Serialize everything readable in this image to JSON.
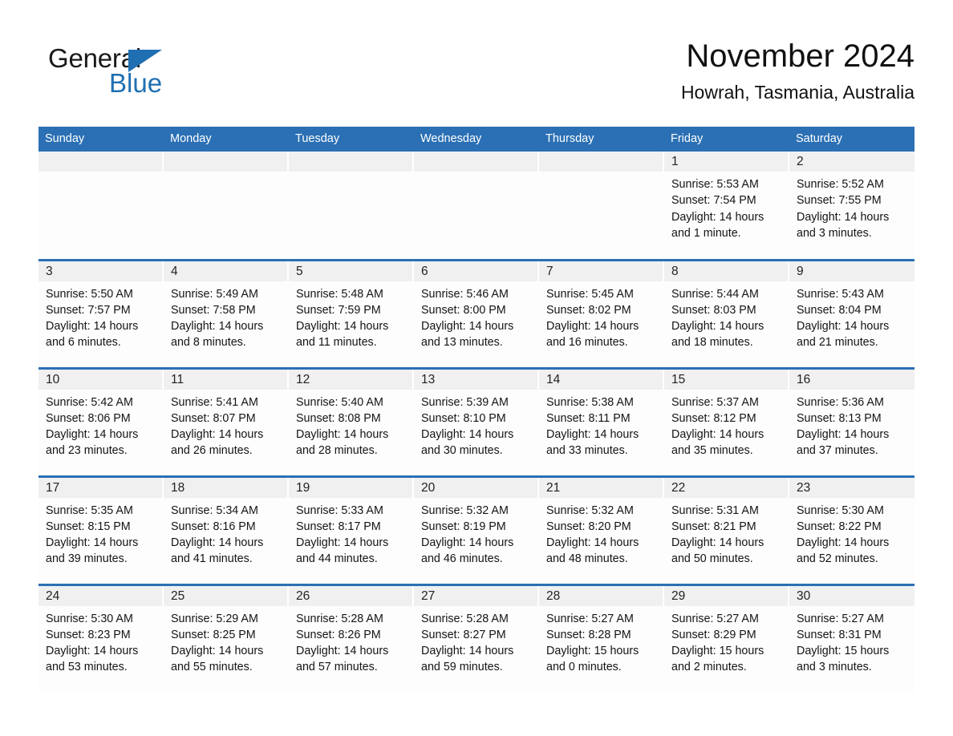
{
  "brand": {
    "word_one": "General",
    "word_two": "Blue",
    "triangle_color": "#1f6fb2"
  },
  "header": {
    "month_title": "November 2024",
    "location": "Howrah, Tasmania, Australia"
  },
  "theme": {
    "header_blue": "#2b70b4",
    "daynum_band": "#f0f0f0",
    "cell_bg": "#fdfdfd",
    "text": "#141414"
  },
  "weekday_headers": [
    "Sunday",
    "Monday",
    "Tuesday",
    "Wednesday",
    "Thursday",
    "Friday",
    "Saturday"
  ],
  "weeks": [
    [
      {
        "day": "",
        "sunrise": "",
        "sunset": "",
        "daylight_line1": "",
        "daylight_line2": ""
      },
      {
        "day": "",
        "sunrise": "",
        "sunset": "",
        "daylight_line1": "",
        "daylight_line2": ""
      },
      {
        "day": "",
        "sunrise": "",
        "sunset": "",
        "daylight_line1": "",
        "daylight_line2": ""
      },
      {
        "day": "",
        "sunrise": "",
        "sunset": "",
        "daylight_line1": "",
        "daylight_line2": ""
      },
      {
        "day": "",
        "sunrise": "",
        "sunset": "",
        "daylight_line1": "",
        "daylight_line2": ""
      },
      {
        "day": "1",
        "sunrise": "Sunrise: 5:53 AM",
        "sunset": "Sunset: 7:54 PM",
        "daylight_line1": "Daylight: 14 hours",
        "daylight_line2": "and 1 minute."
      },
      {
        "day": "2",
        "sunrise": "Sunrise: 5:52 AM",
        "sunset": "Sunset: 7:55 PM",
        "daylight_line1": "Daylight: 14 hours",
        "daylight_line2": "and 3 minutes."
      }
    ],
    [
      {
        "day": "3",
        "sunrise": "Sunrise: 5:50 AM",
        "sunset": "Sunset: 7:57 PM",
        "daylight_line1": "Daylight: 14 hours",
        "daylight_line2": "and 6 minutes."
      },
      {
        "day": "4",
        "sunrise": "Sunrise: 5:49 AM",
        "sunset": "Sunset: 7:58 PM",
        "daylight_line1": "Daylight: 14 hours",
        "daylight_line2": "and 8 minutes."
      },
      {
        "day": "5",
        "sunrise": "Sunrise: 5:48 AM",
        "sunset": "Sunset: 7:59 PM",
        "daylight_line1": "Daylight: 14 hours",
        "daylight_line2": "and 11 minutes."
      },
      {
        "day": "6",
        "sunrise": "Sunrise: 5:46 AM",
        "sunset": "Sunset: 8:00 PM",
        "daylight_line1": "Daylight: 14 hours",
        "daylight_line2": "and 13 minutes."
      },
      {
        "day": "7",
        "sunrise": "Sunrise: 5:45 AM",
        "sunset": "Sunset: 8:02 PM",
        "daylight_line1": "Daylight: 14 hours",
        "daylight_line2": "and 16 minutes."
      },
      {
        "day": "8",
        "sunrise": "Sunrise: 5:44 AM",
        "sunset": "Sunset: 8:03 PM",
        "daylight_line1": "Daylight: 14 hours",
        "daylight_line2": "and 18 minutes."
      },
      {
        "day": "9",
        "sunrise": "Sunrise: 5:43 AM",
        "sunset": "Sunset: 8:04 PM",
        "daylight_line1": "Daylight: 14 hours",
        "daylight_line2": "and 21 minutes."
      }
    ],
    [
      {
        "day": "10",
        "sunrise": "Sunrise: 5:42 AM",
        "sunset": "Sunset: 8:06 PM",
        "daylight_line1": "Daylight: 14 hours",
        "daylight_line2": "and 23 minutes."
      },
      {
        "day": "11",
        "sunrise": "Sunrise: 5:41 AM",
        "sunset": "Sunset: 8:07 PM",
        "daylight_line1": "Daylight: 14 hours",
        "daylight_line2": "and 26 minutes."
      },
      {
        "day": "12",
        "sunrise": "Sunrise: 5:40 AM",
        "sunset": "Sunset: 8:08 PM",
        "daylight_line1": "Daylight: 14 hours",
        "daylight_line2": "and 28 minutes."
      },
      {
        "day": "13",
        "sunrise": "Sunrise: 5:39 AM",
        "sunset": "Sunset: 8:10 PM",
        "daylight_line1": "Daylight: 14 hours",
        "daylight_line2": "and 30 minutes."
      },
      {
        "day": "14",
        "sunrise": "Sunrise: 5:38 AM",
        "sunset": "Sunset: 8:11 PM",
        "daylight_line1": "Daylight: 14 hours",
        "daylight_line2": "and 33 minutes."
      },
      {
        "day": "15",
        "sunrise": "Sunrise: 5:37 AM",
        "sunset": "Sunset: 8:12 PM",
        "daylight_line1": "Daylight: 14 hours",
        "daylight_line2": "and 35 minutes."
      },
      {
        "day": "16",
        "sunrise": "Sunrise: 5:36 AM",
        "sunset": "Sunset: 8:13 PM",
        "daylight_line1": "Daylight: 14 hours",
        "daylight_line2": "and 37 minutes."
      }
    ],
    [
      {
        "day": "17",
        "sunrise": "Sunrise: 5:35 AM",
        "sunset": "Sunset: 8:15 PM",
        "daylight_line1": "Daylight: 14 hours",
        "daylight_line2": "and 39 minutes."
      },
      {
        "day": "18",
        "sunrise": "Sunrise: 5:34 AM",
        "sunset": "Sunset: 8:16 PM",
        "daylight_line1": "Daylight: 14 hours",
        "daylight_line2": "and 41 minutes."
      },
      {
        "day": "19",
        "sunrise": "Sunrise: 5:33 AM",
        "sunset": "Sunset: 8:17 PM",
        "daylight_line1": "Daylight: 14 hours",
        "daylight_line2": "and 44 minutes."
      },
      {
        "day": "20",
        "sunrise": "Sunrise: 5:32 AM",
        "sunset": "Sunset: 8:19 PM",
        "daylight_line1": "Daylight: 14 hours",
        "daylight_line2": "and 46 minutes."
      },
      {
        "day": "21",
        "sunrise": "Sunrise: 5:32 AM",
        "sunset": "Sunset: 8:20 PM",
        "daylight_line1": "Daylight: 14 hours",
        "daylight_line2": "and 48 minutes."
      },
      {
        "day": "22",
        "sunrise": "Sunrise: 5:31 AM",
        "sunset": "Sunset: 8:21 PM",
        "daylight_line1": "Daylight: 14 hours",
        "daylight_line2": "and 50 minutes."
      },
      {
        "day": "23",
        "sunrise": "Sunrise: 5:30 AM",
        "sunset": "Sunset: 8:22 PM",
        "daylight_line1": "Daylight: 14 hours",
        "daylight_line2": "and 52 minutes."
      }
    ],
    [
      {
        "day": "24",
        "sunrise": "Sunrise: 5:30 AM",
        "sunset": "Sunset: 8:23 PM",
        "daylight_line1": "Daylight: 14 hours",
        "daylight_line2": "and 53 minutes."
      },
      {
        "day": "25",
        "sunrise": "Sunrise: 5:29 AM",
        "sunset": "Sunset: 8:25 PM",
        "daylight_line1": "Daylight: 14 hours",
        "daylight_line2": "and 55 minutes."
      },
      {
        "day": "26",
        "sunrise": "Sunrise: 5:28 AM",
        "sunset": "Sunset: 8:26 PM",
        "daylight_line1": "Daylight: 14 hours",
        "daylight_line2": "and 57 minutes."
      },
      {
        "day": "27",
        "sunrise": "Sunrise: 5:28 AM",
        "sunset": "Sunset: 8:27 PM",
        "daylight_line1": "Daylight: 14 hours",
        "daylight_line2": "and 59 minutes."
      },
      {
        "day": "28",
        "sunrise": "Sunrise: 5:27 AM",
        "sunset": "Sunset: 8:28 PM",
        "daylight_line1": "Daylight: 15 hours",
        "daylight_line2": "and 0 minutes."
      },
      {
        "day": "29",
        "sunrise": "Sunrise: 5:27 AM",
        "sunset": "Sunset: 8:29 PM",
        "daylight_line1": "Daylight: 15 hours",
        "daylight_line2": "and 2 minutes."
      },
      {
        "day": "30",
        "sunrise": "Sunrise: 5:27 AM",
        "sunset": "Sunset: 8:31 PM",
        "daylight_line1": "Daylight: 15 hours",
        "daylight_line2": "and 3 minutes."
      }
    ]
  ]
}
